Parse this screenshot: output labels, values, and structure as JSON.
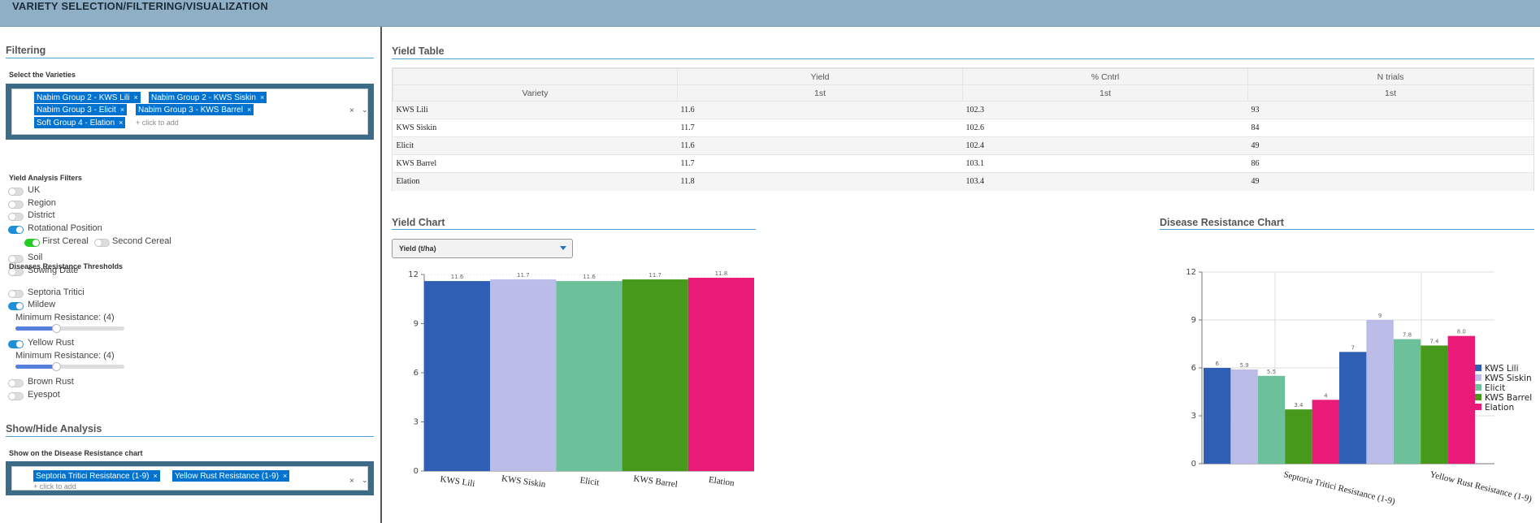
{
  "header": {
    "title": "VARIETY SELECTION/FILTERING/VISUALIZATION"
  },
  "filtering": {
    "title": "Filtering",
    "varieties_label": "Select the Varieties",
    "selected_varieties": [
      "Nabim Group 2 - KWS Lili",
      "Nabim Group 2 - KWS Siskin",
      "Nabim Group 3 - Elicit",
      "Nabim Group 3 - KWS Barrel",
      "Soft Group 4 - Elation"
    ],
    "click_to_add": "+ click to add",
    "clear_symbol": "×",
    "tag_remove_symbol": "×",
    "yield_filters_label": "Yield Analysis Filters",
    "yield_filters": [
      {
        "label": "UK",
        "on": false
      },
      {
        "label": "Region",
        "on": false
      },
      {
        "label": "District",
        "on": false
      },
      {
        "label": "Rotational Position",
        "on": true
      },
      {
        "label": "Soil",
        "on": false
      },
      {
        "label": "Sowing Date",
        "on": false
      }
    ],
    "rotational_sub": [
      {
        "label": "First Cereal",
        "on": true
      },
      {
        "label": "Second Cereal",
        "on": false
      }
    ],
    "disease_label": "Diseases Resistance Thresholds",
    "diseases": [
      {
        "label": "Septoria Tritici",
        "on": false
      },
      {
        "label": "Mildew",
        "on": true,
        "min_label": "Minimum Resistance: (4)",
        "value": 4,
        "max": 9
      },
      {
        "label": "Yellow Rust",
        "on": true,
        "min_label": "Minimum Resistance: (4)",
        "value": 4,
        "max": 9
      },
      {
        "label": "Brown Rust",
        "on": false
      },
      {
        "label": "Eyespot",
        "on": false
      }
    ]
  },
  "show_hide": {
    "title": "Show/Hide Analysis",
    "chart_label": "Show on the Disease Resistance chart",
    "selected": [
      "Septoria Tritici Resistance (1-9)",
      "Yellow Rust Resistance (1-9)"
    ],
    "click_to_add": "+ click to add"
  },
  "yield_table": {
    "title": "Yield Table",
    "group_headers": [
      "",
      "Yield",
      "% Cntrl",
      "N trials"
    ],
    "sub_headers": [
      "Variety",
      "1st",
      "1st",
      "1st"
    ],
    "rows": [
      [
        "KWS Lili",
        "11.6",
        "102.3",
        "93"
      ],
      [
        "KWS Siskin",
        "11.7",
        "102.6",
        "84"
      ],
      [
        "Elicit",
        "11.6",
        "102.4",
        "49"
      ],
      [
        "KWS Barrel",
        "11.7",
        "103.1",
        "86"
      ],
      [
        "Elation",
        "11.8",
        "103.4",
        "49"
      ]
    ]
  },
  "yield_chart": {
    "title": "Yield Chart",
    "select_value": "Yield (t/ha)"
  },
  "disease_chart": {
    "title": "Disease Resistance Chart"
  },
  "colors": {
    "KWS Lili": "#2e5fb4",
    "KWS Siskin": "#bbbde8",
    "Elicit": "#6cc19a",
    "KWS Barrel": "#46991a",
    "Elation": "#ea1a79"
  },
  "chart_data": [
    {
      "type": "bar",
      "categories": [
        "KWS Lili",
        "KWS Siskin",
        "Elicit",
        "KWS Barrel",
        "Elation"
      ],
      "values": [
        11.6,
        11.7,
        11.6,
        11.7,
        11.8
      ],
      "data_labels": [
        "11.6",
        "11.7",
        "11.6",
        "11.7",
        "11.8"
      ],
      "yticks": [
        "0",
        "3",
        "6",
        "9",
        "12"
      ],
      "ylim": [
        0,
        12
      ]
    },
    {
      "type": "bar",
      "categories": [
        "Septoria Tritici Resistance (1-9)",
        "Yellow Rust Resistance (1-9)"
      ],
      "series": [
        {
          "name": "KWS Lili",
          "values": [
            6,
            7
          ],
          "labels": [
            "6",
            "7"
          ]
        },
        {
          "name": "KWS Siskin",
          "values": [
            5.9,
            9
          ],
          "labels": [
            "5.9",
            "9"
          ]
        },
        {
          "name": "Elicit",
          "values": [
            5.5,
            7.8
          ],
          "labels": [
            "5.5",
            "7.8"
          ]
        },
        {
          "name": "KWS Barrel",
          "values": [
            3.4,
            7.4
          ],
          "labels": [
            "3.4",
            "7.4"
          ]
        },
        {
          "name": "Elation",
          "values": [
            4,
            8
          ],
          "labels": [
            "4",
            "8.0"
          ]
        }
      ],
      "yticks": [
        "0",
        "3",
        "6",
        "9",
        "12"
      ],
      "ylim": [
        0,
        12
      ],
      "legend": "right"
    }
  ]
}
